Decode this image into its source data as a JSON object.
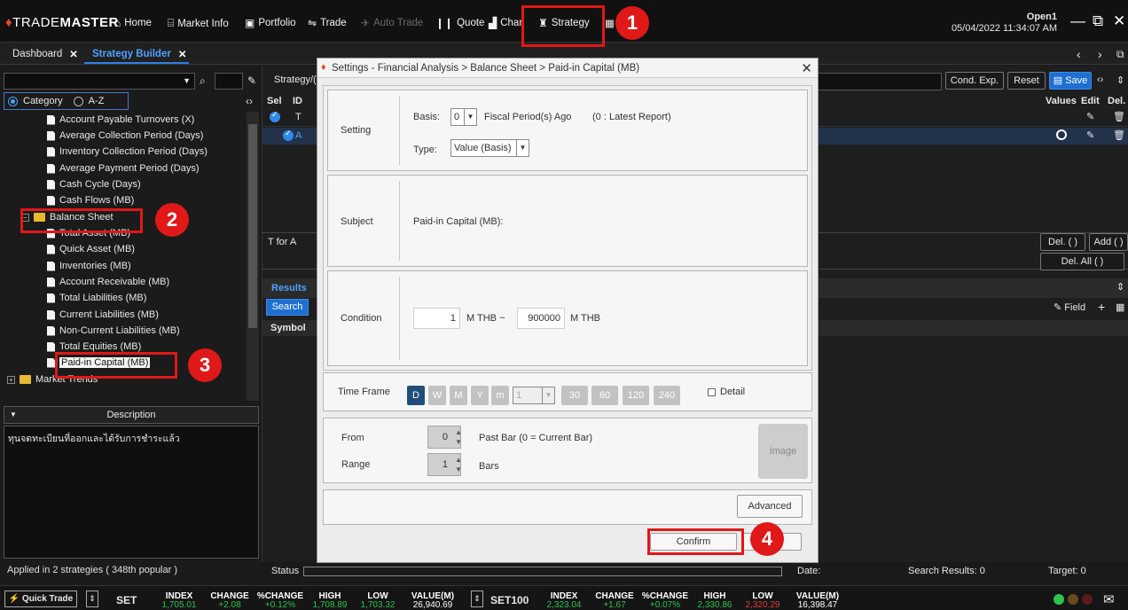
{
  "app": {
    "brand_prefix": "TRADE",
    "brand_suffix": "MASTER"
  },
  "nav": [
    {
      "label": "Home",
      "icon": "home-icon"
    },
    {
      "label": "Market Info",
      "icon": "bank-icon"
    },
    {
      "label": "Portfolio",
      "icon": "briefcase-icon"
    },
    {
      "label": "Trade",
      "icon": "exchange-icon"
    },
    {
      "label": "Auto Trade",
      "icon": "auto-trade-icon"
    },
    {
      "label": "Quote",
      "icon": "quote-icon"
    },
    {
      "label": "Char",
      "icon": "chart-icon"
    },
    {
      "label": "Strategy",
      "icon": "strategy-icon"
    }
  ],
  "user": {
    "name": "Open1",
    "datetime": "05/04/2022 11:34:07 AM"
  },
  "tabs": [
    {
      "label": "Dashboard"
    },
    {
      "label": "Strategy Builder"
    }
  ],
  "left": {
    "radio_category": "Category",
    "radio_az": "A-Z",
    "tree": [
      "Account Payable Turnovers (X)",
      "Average Collection Period (Days)",
      "Inventory Collection Period (Days)",
      "Average Payment Period (Days)",
      "Cash Cycle (Days)",
      "Cash Flows (MB)",
      "Balance Sheet",
      "Total Asset (MB)",
      "Quick Asset (MB)",
      "Inventories (MB)",
      "Account Receivable (MB)",
      "Total Liabilities (MB)",
      "Current Liabilities (MB)",
      "Non-Current Liabilities (MB)",
      "Total Equities (MB)",
      "Paid-in Capital (MB)",
      "Market Trends"
    ],
    "description_header": "Description",
    "description_text": "ทุนจดทะเบียนที่ออกและได้รับการชำระแล้ว",
    "applied": "Applied in 2 strategies ( 348th popular )"
  },
  "right": {
    "strategy_label": "Strategy/(",
    "cond_exp": "Cond. Exp.",
    "reset": "Reset",
    "save": "Save",
    "grid_headers": {
      "sel": "Sel",
      "id": "ID",
      "values": "Values",
      "edit": "Edit",
      "del": "Del."
    },
    "rows": [
      {
        "id": "T"
      },
      {
        "id": "A"
      }
    ],
    "expr": "T for A",
    "del_btn": "Del. ( )",
    "add_btn": "Add ( )",
    "del_all": "Del. All ( )",
    "results_tab": "Results",
    "search_btn": "Search",
    "symbol_col": "Symbol",
    "field_btn": "Field"
  },
  "status": {
    "status_label": "Status",
    "date_label": "Date:",
    "search_results": "Search Results:  0",
    "target": "Target:  0"
  },
  "modal": {
    "title": "Settings - Financial Analysis > Balance Sheet > Paid-in Capital (MB)",
    "setting_label": "Setting",
    "basis_label": "Basis:",
    "basis_value": "0",
    "basis_suffix": "Fiscal Period(s) Ago",
    "basis_hint": "(0 : Latest Report)",
    "type_label": "Type:",
    "type_value": "Value (Basis)",
    "subject_label": "Subject",
    "subject_value": "Paid-in Capital (MB):",
    "condition_label": "Condition",
    "cond_min": "1",
    "cond_min_unit": "M THB ~",
    "cond_max": "900000",
    "cond_max_unit": "M THB",
    "timeframe_label": "Time Frame",
    "timeframes": [
      "D",
      "W",
      "M",
      "Y",
      "m"
    ],
    "tf_select": "1",
    "tf_minutes": [
      "30",
      "60",
      "120",
      "240"
    ],
    "detail_label": "Detail",
    "from_label": "From",
    "from_value": "0",
    "from_suffix": "Past Bar (0 = Current Bar)",
    "range_label": "Range",
    "range_value": "1",
    "range_suffix": "Bars",
    "image_btn": "Image",
    "advanced_btn": "Advanced",
    "confirm_btn": "Confirm"
  },
  "ticker": {
    "quick_trade": "Quick Trade",
    "set_name": "SET",
    "set100_name": "SET100",
    "cols": [
      "INDEX",
      "CHANGE",
      "%CHANGE",
      "HIGH",
      "LOW",
      "VALUE(M)"
    ],
    "set_vals": [
      "1,705.01",
      "+2.08",
      "+0.12%",
      "1,708.89",
      "1,703.32",
      "26,940.69"
    ],
    "set100_vals": [
      "2,323.04",
      "+1.67",
      "+0.07%",
      "2,330.86",
      "2,320.29",
      "16,398.47"
    ]
  },
  "markers": [
    "1",
    "2",
    "3",
    "4"
  ]
}
